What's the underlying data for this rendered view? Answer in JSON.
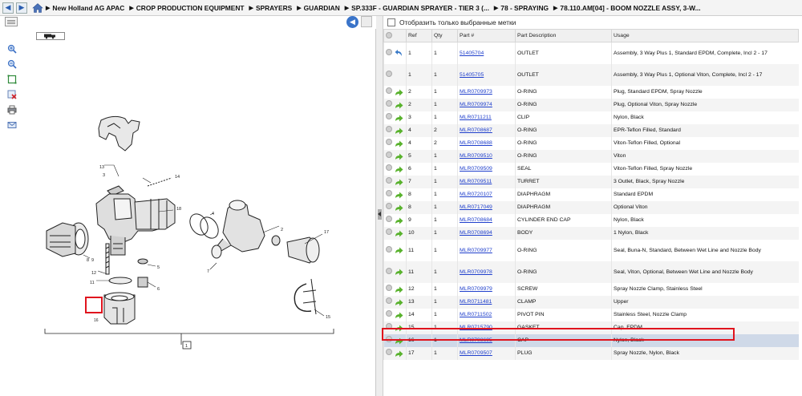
{
  "breadcrumb": [
    "New Holland AG APAC",
    "CROP PRODUCTION EQUIPMENT",
    "SPRAYERS",
    "GUARDIAN",
    "SP.333F - GUARDIAN SPRAYER - TIER 3 (...",
    "78 - SPRAYING",
    "78.110.AM[04] - BOOM NOZZLE ASSY, 3-W..."
  ],
  "filter": {
    "label": "Отобразить только выбранные метки",
    "checked": false
  },
  "table": {
    "columns": [
      "",
      "Ref",
      "Qty",
      "Part #",
      "Part Description",
      "Usage"
    ],
    "rows": [
      {
        "ref": "1",
        "qty": "1",
        "part": "51405704",
        "desc": "OUTLET",
        "usage": "Assembly, 3 Way Plus 1, Standard EPDM, Complete, Incl 2 - 17",
        "icon": "undo-icon",
        "tall": true
      },
      {
        "ref": "1",
        "qty": "1",
        "part": "51405705",
        "desc": "OUTLET",
        "usage": "Assembly, 3 Way Plus 1, Optional Viton, Complete, Incl 2 - 17",
        "icon": "none",
        "tall": true
      },
      {
        "ref": "2",
        "qty": "1",
        "part": "MLR0709973",
        "desc": "O-RING",
        "usage": "Plug, Standard EPDM, Spray Nozzle",
        "icon": "arrow"
      },
      {
        "ref": "2",
        "qty": "1",
        "part": "MLR0709974",
        "desc": "O-RING",
        "usage": "Plug, Optional Viton, Spray Nozzle",
        "icon": "arrow"
      },
      {
        "ref": "3",
        "qty": "1",
        "part": "MLR0711211",
        "desc": "CLIP",
        "usage": "Nylon, Black",
        "icon": "arrow"
      },
      {
        "ref": "4",
        "qty": "2",
        "part": "MLR0708687",
        "desc": "O-RING",
        "usage": "EPR-Teflon Filled, Standard",
        "icon": "arrow"
      },
      {
        "ref": "4",
        "qty": "2",
        "part": "MLR0708688",
        "desc": "O-RING",
        "usage": "Viton-Teflon Filled, Optional",
        "icon": "arrow"
      },
      {
        "ref": "5",
        "qty": "1",
        "part": "MLR0709510",
        "desc": "O-RING",
        "usage": "Viton",
        "icon": "arrow"
      },
      {
        "ref": "6",
        "qty": "1",
        "part": "MLR0709509",
        "desc": "SEAL",
        "usage": "Viton-Teflon Filled, Spray Nozzle",
        "icon": "arrow"
      },
      {
        "ref": "7",
        "qty": "1",
        "part": "MLR0709511",
        "desc": "TURRET",
        "usage": "3 Outlet, Black, Spray Nozzle",
        "icon": "arrow"
      },
      {
        "ref": "8",
        "qty": "1",
        "part": "MLR0720107",
        "desc": "DIAPHRAGM",
        "usage": "Standard EPDM",
        "icon": "arrow"
      },
      {
        "ref": "8",
        "qty": "1",
        "part": "MLR0717049",
        "desc": "DIAPHRAGM",
        "usage": "Optional Viton",
        "icon": "arrow"
      },
      {
        "ref": "9",
        "qty": "1",
        "part": "MLR0708684",
        "desc": "CYLINDER END CAP",
        "usage": "Nylon, Black",
        "icon": "arrow"
      },
      {
        "ref": "10",
        "qty": "1",
        "part": "MLR0708694",
        "desc": "BODY",
        "usage": "1 Nylon, Black",
        "icon": "arrow"
      },
      {
        "ref": "11",
        "qty": "1",
        "part": "MLR0709977",
        "desc": "O-RING",
        "usage": "Seal, Buna-N, Standard, Between Wet Line and Nozzle Body",
        "icon": "arrow",
        "tall": true
      },
      {
        "ref": "11",
        "qty": "1",
        "part": "MLR0709978",
        "desc": "O-RING",
        "usage": "Seal, Viton, Optional, Between Wet Line and Nozzle Body",
        "icon": "arrow",
        "tall": true
      },
      {
        "ref": "12",
        "qty": "1",
        "part": "MLR0709979",
        "desc": "SCREW",
        "usage": "Spray Nozzle Clamp, Stainless Steel",
        "icon": "arrow"
      },
      {
        "ref": "13",
        "qty": "1",
        "part": "MLR0711481",
        "desc": "CLAMP",
        "usage": "Upper",
        "icon": "arrow"
      },
      {
        "ref": "14",
        "qty": "1",
        "part": "MLR0711502",
        "desc": "PIVOT PIN",
        "usage": "Stainless Steel, Nozzle Clamp",
        "icon": "arrow"
      },
      {
        "ref": "15",
        "qty": "1",
        "part": "MLR0715790",
        "desc": "GASKET",
        "usage": "Cap, EPDM",
        "icon": "arrow"
      },
      {
        "ref": "16",
        "qty": "1",
        "part": "MLR0708695",
        "desc": "CAP",
        "usage": "Nylon, Black",
        "icon": "arrow",
        "selected": true
      },
      {
        "ref": "17",
        "qty": "1",
        "part": "MLR0709507",
        "desc": "PLUG",
        "usage": "Spray Nozzle, Nylon, Black",
        "icon": "arrow"
      }
    ]
  },
  "diagram": {
    "callouts": [
      "1",
      "2",
      "3",
      "4",
      "5",
      "6",
      "7",
      "8",
      "9",
      "10",
      "11",
      "12",
      "13",
      "14",
      "15",
      "16",
      "17",
      "18"
    ],
    "highlighted_callout": "16"
  },
  "colors": {
    "highlight": "#e0141e",
    "link": "#1f3fcc",
    "selected_row": "#cfd9e8",
    "arrow": "#59b22d"
  }
}
